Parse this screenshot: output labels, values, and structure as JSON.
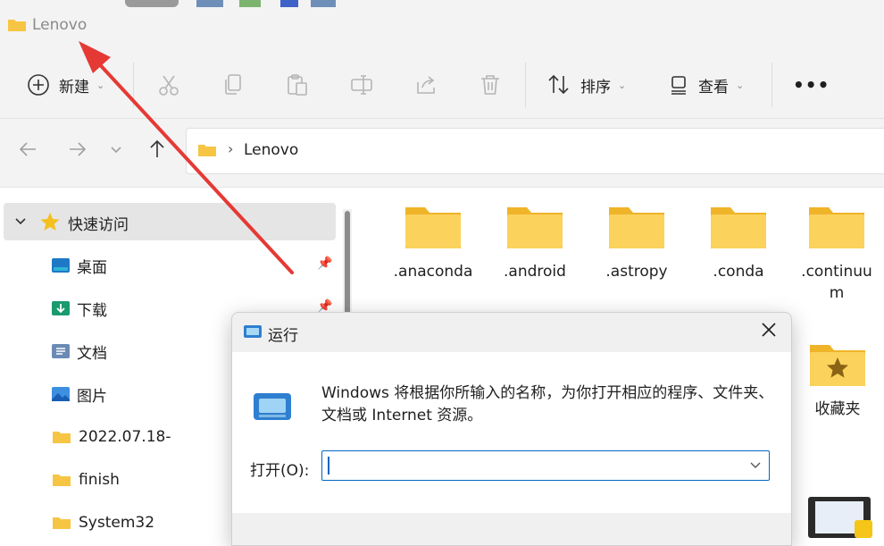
{
  "window": {
    "title": "Lenovo"
  },
  "toolbar": {
    "new_label": "新建",
    "sort_label": "排序",
    "view_label": "查看",
    "more_label": "•••"
  },
  "address": {
    "path": "Lenovo"
  },
  "sidebar": {
    "quick_access": "快速访问",
    "items": [
      {
        "label": "桌面",
        "icon": "desktop-icon",
        "pinned": true
      },
      {
        "label": "下载",
        "icon": "download-icon",
        "pinned": true
      },
      {
        "label": "文档",
        "icon": "document-icon",
        "pinned": false
      },
      {
        "label": "图片",
        "icon": "picture-icon",
        "pinned": false
      },
      {
        "label": "2022.07.18-",
        "icon": "folder-icon",
        "pinned": false
      },
      {
        "label": "finish",
        "icon": "folder-icon",
        "pinned": false
      },
      {
        "label": "System32",
        "icon": "folder-icon",
        "pinned": false
      }
    ]
  },
  "files": [
    {
      "name": ".anaconda"
    },
    {
      "name": ".android"
    },
    {
      "name": ".astropy"
    },
    {
      "name": ".conda"
    },
    {
      "name": ".continuum",
      "line1": ".continuu",
      "line2": "m"
    },
    {
      "name": "收藏夹"
    }
  ],
  "run_dialog": {
    "title": "运行",
    "description": "Windows 将根据你所输入的名称，为你打开相应的程序、文件夹、文档或 Internet 资源。",
    "open_label": "打开(O):",
    "input_value": ""
  },
  "colors": {
    "accent": "#0067c0",
    "arrow": "#e53935",
    "folder": "#f6c544"
  }
}
